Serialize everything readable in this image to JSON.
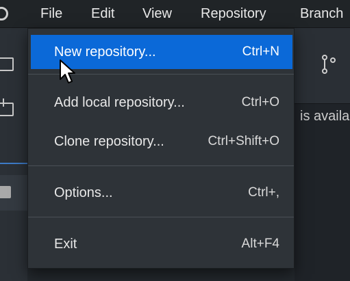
{
  "menubar": {
    "items": [
      "File",
      "Edit",
      "View",
      "Repository",
      "Branch"
    ]
  },
  "file_menu": {
    "items": [
      {
        "label": "New repository...",
        "shortcut": "Ctrl+N",
        "highlighted": true
      },
      {
        "label": "Add local repository...",
        "shortcut": "Ctrl+O"
      },
      {
        "label": "Clone repository...",
        "shortcut": "Ctrl+Shift+O"
      },
      {
        "label": "Options...",
        "shortcut": "Ctrl+,"
      },
      {
        "label": "Exit",
        "shortcut": "Alt+F4"
      }
    ]
  },
  "background": {
    "partial_text": "is availa"
  },
  "colors": {
    "highlight": "#0b69d8",
    "menu_bg": "#2e3338",
    "menubar_bg": "#202427"
  },
  "icons": [
    "github-logo-icon",
    "monitor-icon",
    "download-icon",
    "checkbox-icon",
    "branch-icon",
    "mouse-cursor-icon"
  ]
}
